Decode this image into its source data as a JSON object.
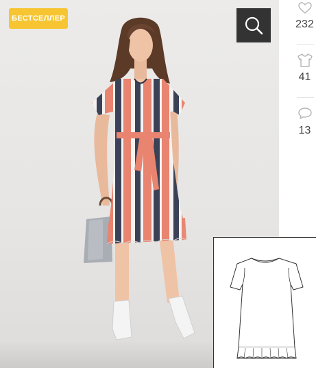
{
  "product": {
    "badge_label": "БЕСТСЕЛЛЕР",
    "image_alt": "model-photo-striped-dress"
  },
  "toolbar": {
    "search_icon": "magnifier-icon"
  },
  "stats": {
    "likes": {
      "icon": "heart-icon",
      "count": "232"
    },
    "sewn": {
      "icon": "tshirt-icon",
      "count": "41"
    },
    "comments": {
      "icon": "speech-bubble-icon",
      "count": "13"
    }
  },
  "colors": {
    "badge": "#f6c531",
    "search_bg": "#333333",
    "stripe_coral": "#e88470",
    "stripe_navy": "#3b4257",
    "stripe_white": "#f5f3f1"
  }
}
